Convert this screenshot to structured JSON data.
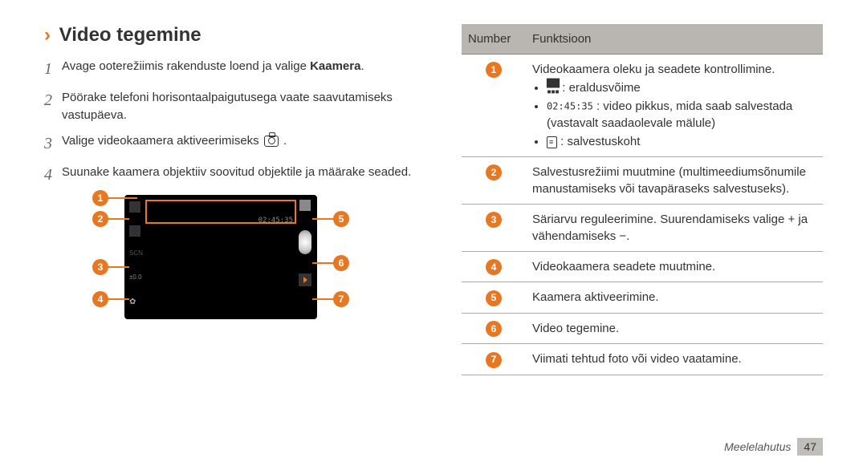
{
  "section": {
    "chevron": "›",
    "title": "Video tegemine"
  },
  "steps": [
    {
      "n": "1",
      "html": "Avage ooterežiimis rakenduste loend ja valige <b>Kaamera</b>."
    },
    {
      "n": "2",
      "html": "Pöörake telefoni horisontaalpaigutusega vaate saavutamiseks vastupäeva."
    },
    {
      "n": "3",
      "html": "Valige videokaamera aktiveerimiseks <span class='cam-icon'></span> ."
    },
    {
      "n": "4",
      "html": "Suunake kaamera objektiiv soovitud objektile ja määrake seaded."
    }
  ],
  "shot": {
    "time_overlay": "02:45:35",
    "left_icons": [
      "res-icon",
      "mms-icon",
      "scn-icon",
      "ev-icon",
      "gear-icon"
    ]
  },
  "callouts": [
    "1",
    "2",
    "3",
    "4",
    "5",
    "6",
    "7"
  ],
  "table": {
    "headers": [
      "Number",
      "Funktsioon"
    ],
    "rows": [
      {
        "num": "1",
        "text": "Videokaamera oleku ja seadete kontrollimine.",
        "bullets": [
          {
            "icon": "dots",
            "label": "eraldusvõime"
          },
          {
            "icon": "time",
            "code": "02:45:35",
            "label": "video pikkus, mida saab salvestada (vastavalt saadaolevale mälule)"
          },
          {
            "icon": "sd",
            "label": "salvestuskoht"
          }
        ]
      },
      {
        "num": "2",
        "text": "Salvestusrežiimi muutmine (multimeediumsõnumile manustamiseks või tavapäraseks salvestuseks)."
      },
      {
        "num": "3",
        "text": "Säriarvu reguleerimine. Suurendamiseks valige + ja vähendamiseks −."
      },
      {
        "num": "4",
        "text": "Videokaamera seadete muutmine."
      },
      {
        "num": "5",
        "text": "Kaamera aktiveerimine."
      },
      {
        "num": "6",
        "text": "Video tegemine."
      },
      {
        "num": "7",
        "text": "Viimati tehtud foto või video vaatamine."
      }
    ]
  },
  "footer": {
    "label": "Meelelahutus",
    "page": "47"
  }
}
